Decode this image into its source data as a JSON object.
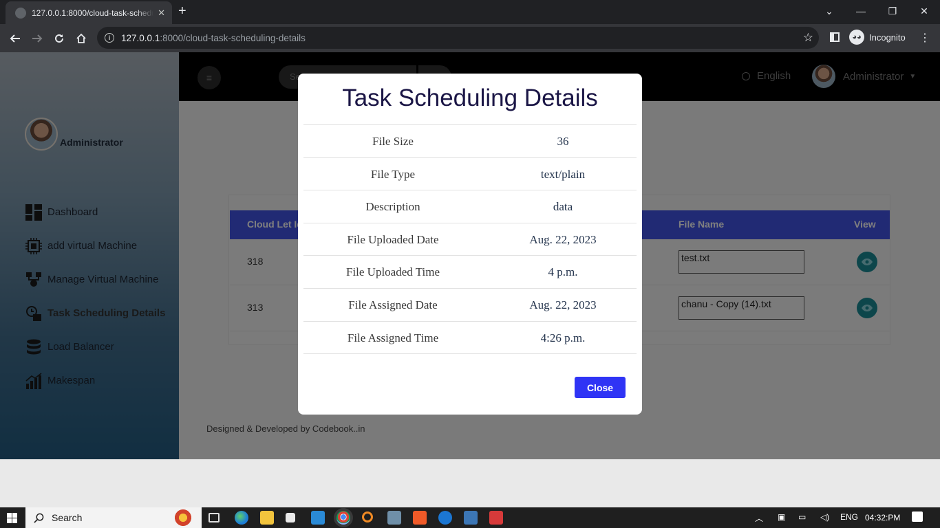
{
  "browser": {
    "tab_title": "127.0.0.1:8000/cloud-task-scheduling-details",
    "tab_close": "✕",
    "new_tab": "+",
    "url_host": "127.0.0.1",
    "url_rest": ":8000/cloud-task-scheduling-details",
    "profile_label": "Incognito",
    "window_controls": {
      "chevron": "⌄",
      "minimize": "—",
      "restore": "❐",
      "close": "✕"
    }
  },
  "topbar": {
    "search_placeholder": "Se",
    "language": "English",
    "user": "Administrator"
  },
  "sidebar": {
    "profile_name": "Administrator",
    "items": [
      {
        "label": "Dashboard",
        "icon": "dashboard-icon"
      },
      {
        "label": "add virtual Machine",
        "icon": "cpu-chip-icon"
      },
      {
        "label": "Manage Virtual Machine",
        "icon": "network-icon"
      },
      {
        "label": "Task Scheduling Details",
        "icon": "task-schedule-icon",
        "active": true
      },
      {
        "label": "Load Balancer",
        "icon": "database-icon"
      },
      {
        "label": "Makespan",
        "icon": "bar-chart-icon"
      }
    ]
  },
  "table": {
    "headers": {
      "cloudlet_id": "Cloud Let Id",
      "file_name": "File Name",
      "view": "View"
    },
    "rows": [
      {
        "id": "318",
        "file_name": "test.txt"
      },
      {
        "id": "313",
        "file_name": "chanu - Copy (14).txt"
      }
    ]
  },
  "footer": "Designed & Developed by Codebook..in",
  "modal": {
    "title": "Task Scheduling Details",
    "rows": [
      {
        "label": "File Size",
        "value": "36"
      },
      {
        "label": "File Type",
        "value": "text/plain"
      },
      {
        "label": "Description",
        "value": "data"
      },
      {
        "label": "File Uploaded Date",
        "value": "Aug. 22, 2023"
      },
      {
        "label": "File Uploaded Time",
        "value": "4 p.m."
      },
      {
        "label": "File Assigned Date",
        "value": "Aug. 22, 2023"
      },
      {
        "label": "File Assigned Time",
        "value": "4:26 p.m."
      }
    ],
    "close_label": "Close"
  },
  "taskbar": {
    "search_label": "Search",
    "language": "ENG",
    "time": "04:32:PM"
  },
  "colors": {
    "accent_blue": "#4254e8",
    "close_button": "#2f34f5",
    "view_button": "#1a8c97",
    "modal_title": "#1b1646"
  }
}
